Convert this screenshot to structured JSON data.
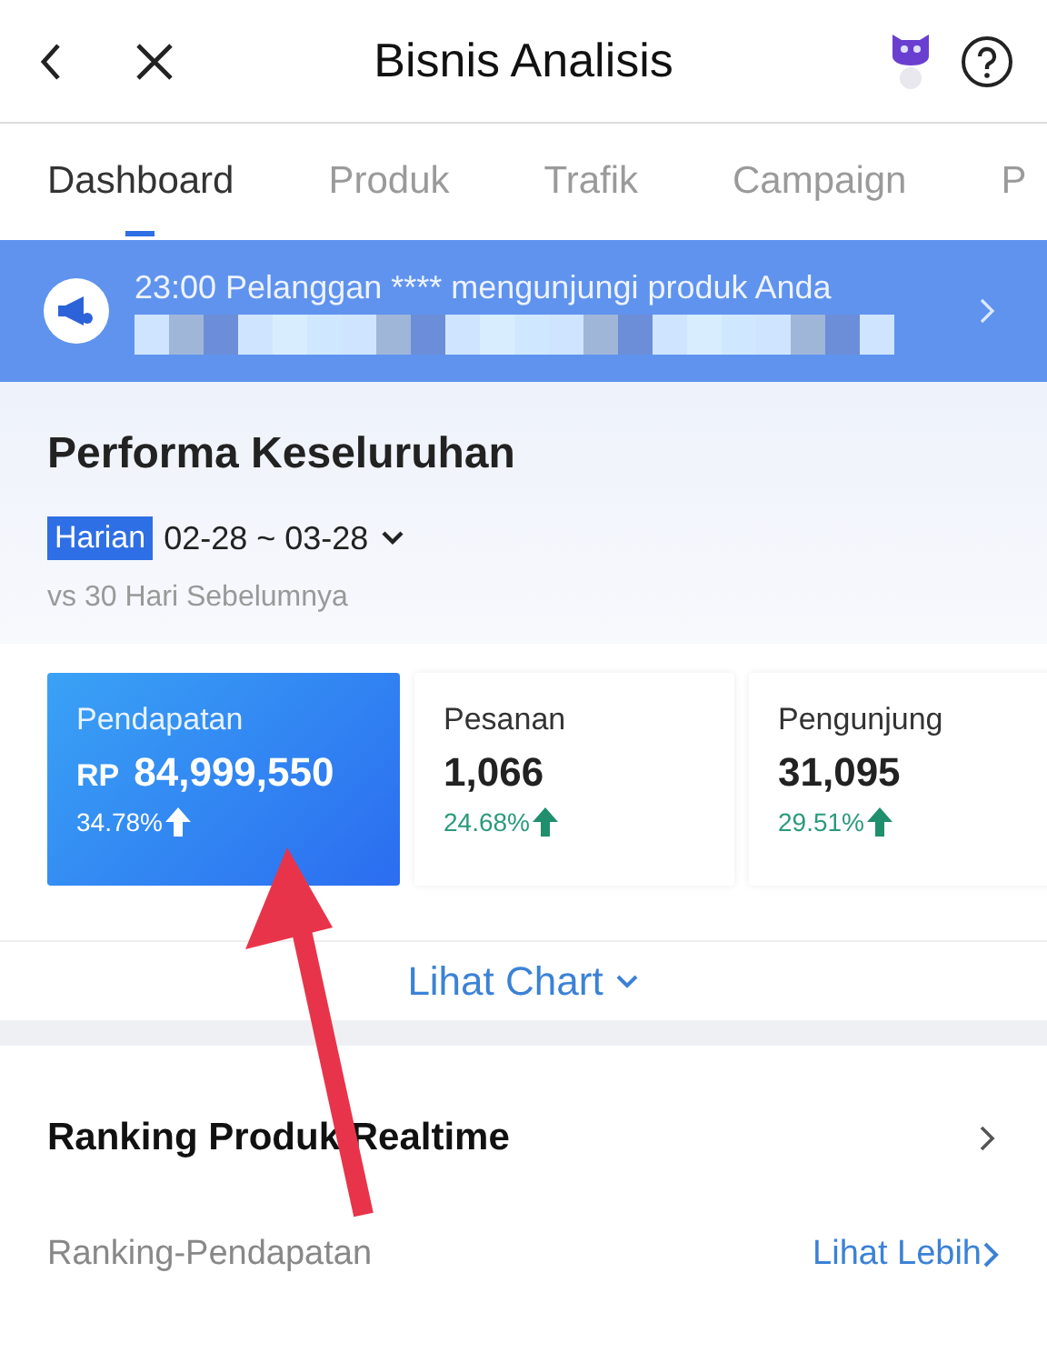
{
  "header": {
    "title": "Bisnis Analisis"
  },
  "tabs": [
    {
      "label": "Dashboard",
      "selected": true
    },
    {
      "label": "Produk",
      "selected": false
    },
    {
      "label": "Trafik",
      "selected": false
    },
    {
      "label": "Campaign",
      "selected": false
    },
    {
      "label": "P",
      "selected": false
    }
  ],
  "notice": {
    "text": "23:00 Pelanggan **** mengunjungi produk Anda"
  },
  "overview": {
    "title": "Performa Keseluruhan",
    "period_tag": "Harian",
    "date_range": "02-28 ~ 03-28",
    "comparison": "vs 30 Hari Sebelumnya"
  },
  "metrics": [
    {
      "label": "Pendapatan",
      "currency": "RP",
      "value": "84,999,550",
      "change": "34.78%",
      "selected": true
    },
    {
      "label": "Pesanan",
      "value": "1,066",
      "change": "24.68%",
      "selected": false
    },
    {
      "label": "Pengunjung",
      "value": "31,095",
      "change": "29.51%",
      "selected": false
    }
  ],
  "chart_toggle": "Lihat Chart",
  "ranking": {
    "title": "Ranking Produk Realtime",
    "subtitle": "Ranking-Pendapatan",
    "more_link": "Lihat Lebih"
  }
}
